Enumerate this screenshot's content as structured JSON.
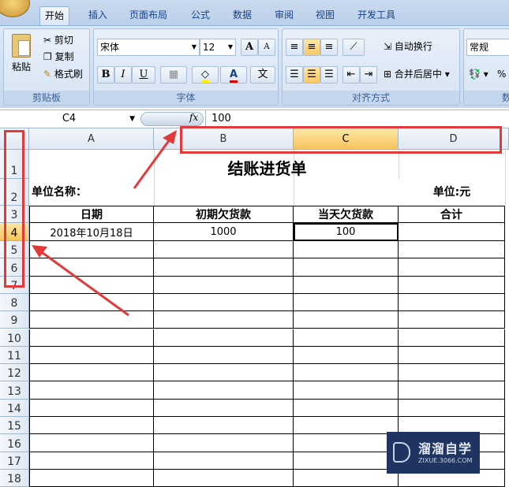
{
  "tabs": [
    "开始",
    "插入",
    "页面布局",
    "公式",
    "数据",
    "审阅",
    "视图",
    "开发工具"
  ],
  "clipboard": {
    "paste": "粘贴",
    "cut": "剪切",
    "copy": "复制",
    "format_painter": "格式刷",
    "label": "剪贴板"
  },
  "font": {
    "name": "宋体",
    "size": "12",
    "label": "字体",
    "bold": "B",
    "italic": "I",
    "underline": "U",
    "grow": "A",
    "shrink": "A",
    "font_color": "A",
    "phonetic": "文"
  },
  "alignment": {
    "wrap": "自动换行",
    "merge": "合并后居中",
    "label": "对齐方式"
  },
  "number": {
    "format": "常规",
    "percent": "%",
    "label": "数"
  },
  "formula_bar": {
    "name_box": "C4",
    "fx": "fx",
    "value": "100"
  },
  "columns": [
    "A",
    "B",
    "C",
    "D"
  ],
  "rows": [
    "1",
    "2",
    "3",
    "4",
    "5",
    "6",
    "7",
    "8",
    "9",
    "10",
    "11",
    "12",
    "13",
    "14",
    "15",
    "16",
    "17",
    "18"
  ],
  "sheet": {
    "title": "结账进货单",
    "unit_name_label": "单位名称：",
    "unit_label": "单位:元",
    "headers": [
      "日期",
      "初期欠货款",
      "当天欠货款",
      "合计"
    ],
    "row4": [
      "2018年10月18日",
      "1000",
      "100",
      ""
    ]
  },
  "watermark": {
    "name": "溜溜自学",
    "url": "ZIXUE.3066.COM"
  },
  "colors": {
    "annotation": "#e03a3a",
    "selected": "#f9c866",
    "watermark_bg": "#1f3461"
  }
}
